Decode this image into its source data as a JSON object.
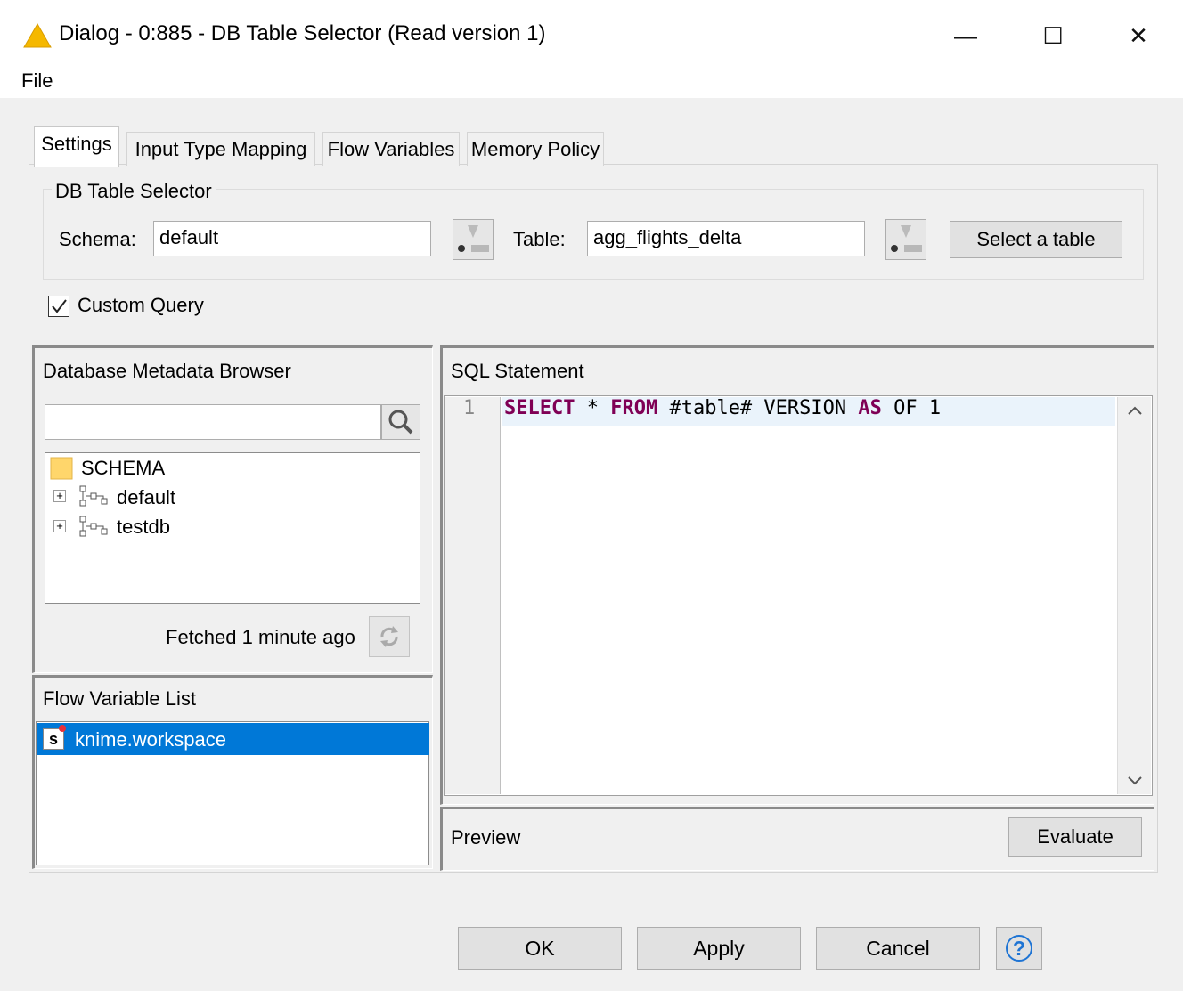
{
  "window": {
    "title": "Dialog - 0:885 - DB Table Selector (Read version 1)",
    "minimize": "—",
    "maximize": "☐",
    "close": "✕"
  },
  "menu": {
    "file": "File"
  },
  "tabs": [
    {
      "label": "Settings",
      "active": true
    },
    {
      "label": "Input Type Mapping",
      "active": false
    },
    {
      "label": "Flow Variables",
      "active": false
    },
    {
      "label": "Memory Policy",
      "active": false
    }
  ],
  "selector": {
    "group_title": "DB Table Selector",
    "schema_label": "Schema:",
    "schema_value": "default",
    "table_label": "Table:",
    "table_value": "agg_flights_delta",
    "select_table_button": "Select a table"
  },
  "custom_query": {
    "label": "Custom Query",
    "checked": true
  },
  "metadata_browser": {
    "title": "Database Metadata Browser",
    "search_value": "",
    "root": "SCHEMA",
    "items": [
      "default",
      "testdb"
    ],
    "fetched": "Fetched 1 minute ago"
  },
  "flow_variables": {
    "title": "Flow Variable List",
    "items": [
      {
        "type_badge": "s",
        "name": "knime.workspace",
        "selected": true
      }
    ]
  },
  "sql": {
    "title": "SQL Statement",
    "line_number": "1",
    "tokens": [
      {
        "text": "SELECT",
        "keyword": true
      },
      {
        "text": " * ",
        "keyword": false
      },
      {
        "text": "FROM",
        "keyword": true
      },
      {
        "text": " #table# VERSION ",
        "keyword": false
      },
      {
        "text": "AS",
        "keyword": true
      },
      {
        "text": " OF 1",
        "keyword": false
      }
    ]
  },
  "preview": {
    "label": "Preview",
    "evaluate_button": "Evaluate"
  },
  "buttons": {
    "ok": "OK",
    "apply": "Apply",
    "cancel": "Cancel",
    "help": "?"
  },
  "colors": {
    "accent_selection": "#0078d7",
    "sql_keyword": "#7f0055",
    "warning_icon": "#f5b800",
    "help_icon": "#1e74d4",
    "variable_badge_dot": "#e8303a"
  }
}
